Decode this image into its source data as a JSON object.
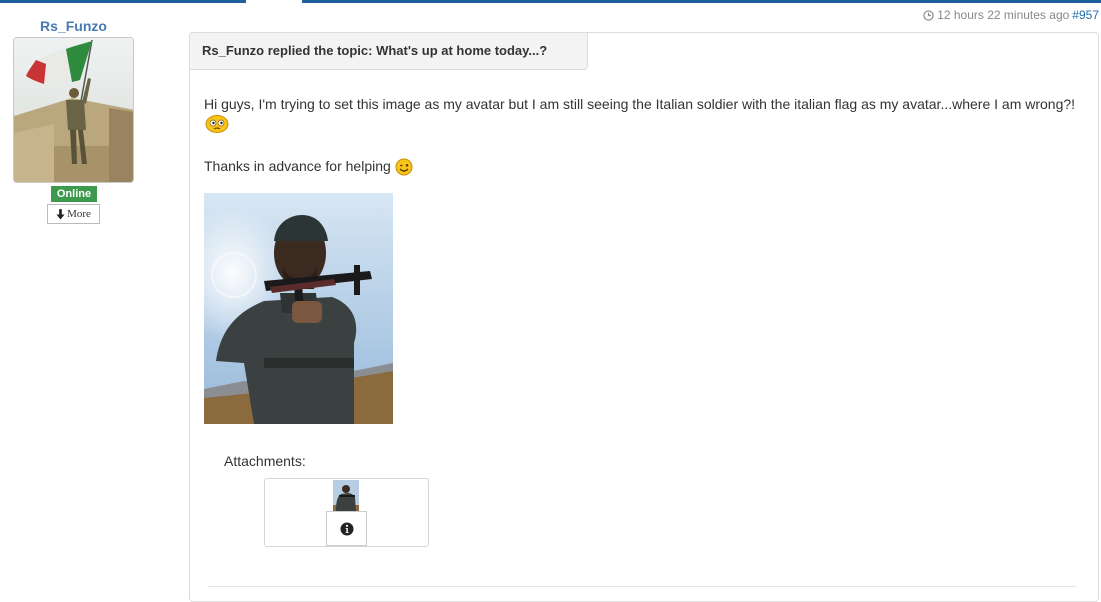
{
  "post": {
    "author": "Rs_Funzo",
    "status": "Online",
    "more_label": "More",
    "time_ago": "12 hours 22 minutes ago",
    "post_number": "#957",
    "title": "Rs_Funzo replied the topic: What's up at home today...?",
    "body_line1": "Hi guys, I'm trying to set this image as my avatar but I am still seeing the Italian soldier with the italian flag as my avatar...where I am wrong?!",
    "body_line2": "Thanks in advance for helping",
    "attachments_label": "Attachments:"
  },
  "icons": [
    "clock-icon",
    "arrow-down-icon",
    "confused-smiley-icon",
    "wink-smiley-icon",
    "info-icon"
  ],
  "colors": {
    "topbar": "#1f5f9e",
    "username": "#4a7ab0",
    "online": "#3d9a4c",
    "link": "#1f6bb0"
  }
}
